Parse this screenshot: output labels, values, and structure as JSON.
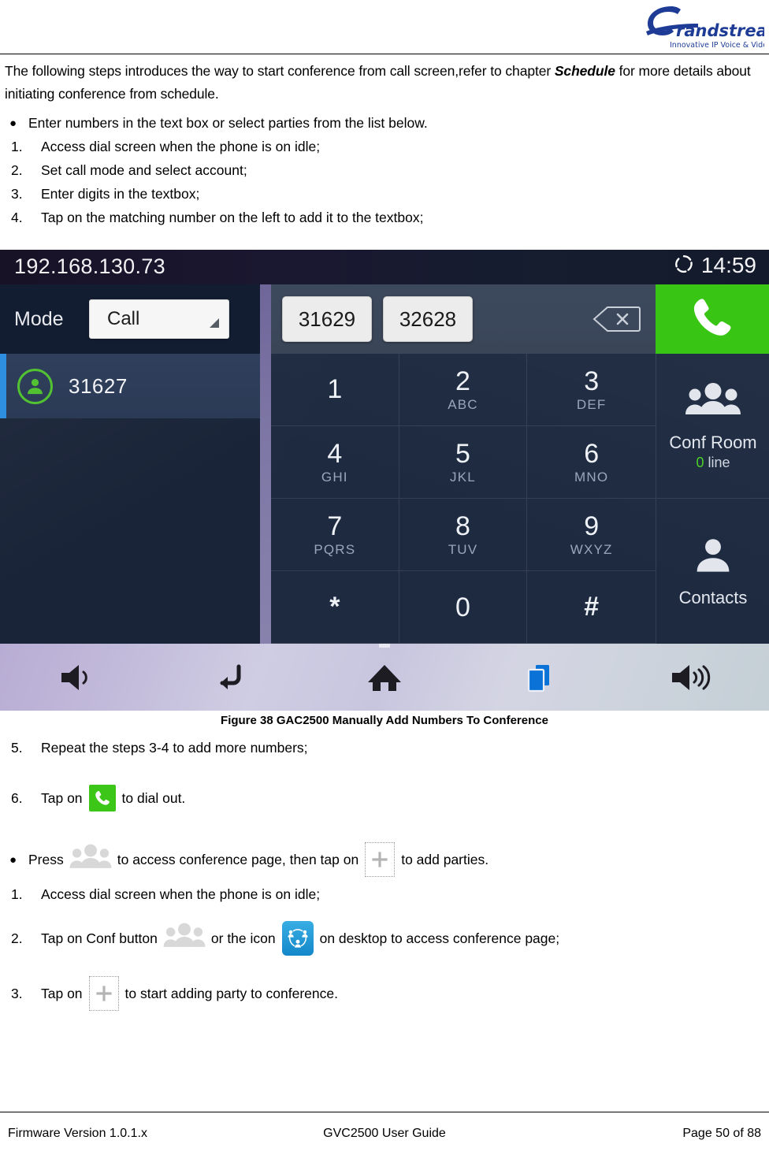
{
  "header": {
    "logo_name": "Grandstream",
    "logo_tagline": "Innovative IP Voice & Video"
  },
  "body": {
    "intro_part1": "The following steps introduces the way to start conference from call screen,refer to chapter ",
    "intro_emphasis": "Schedule",
    "intro_part2": " for more details about initiating conference from schedule.",
    "bullet1": "Enter numbers in the text box or select parties from the list below.",
    "steps_before": [
      {
        "index": "1.",
        "text": "Access dial screen when the phone is on idle;"
      },
      {
        "index": "2.",
        "text": "Set call mode and select account;"
      },
      {
        "index": "3.",
        "text": "Enter digits in the textbox;"
      },
      {
        "index": "4.",
        "text": "Tap on the matching number on the left to add it to the textbox;"
      }
    ]
  },
  "figure": {
    "caption": "Figure 38 GAC2500 Manually Add Numbers To Conference"
  },
  "screenshot": {
    "status": {
      "ip_address": "192.168.130.73",
      "clock": "14:59",
      "status_icon": "sync-circle-icon"
    },
    "mode": {
      "label": "Mode",
      "selected": "Call",
      "caret_icon": "dropdown-caret-icon"
    },
    "contact_list": [
      {
        "number": "31627",
        "avatar_icon": "contact-avatar-icon",
        "selected": true
      }
    ],
    "input": {
      "chips": [
        "31629",
        "32628"
      ],
      "backspace_icon": "backspace-icon"
    },
    "call_button": {
      "icon": "phone-handset-icon",
      "color": "#38c513"
    },
    "dialpad": [
      {
        "digit": "1",
        "letters": ""
      },
      {
        "digit": "2",
        "letters": "ABC"
      },
      {
        "digit": "3",
        "letters": "DEF"
      },
      {
        "digit": "4",
        "letters": "GHI"
      },
      {
        "digit": "5",
        "letters": "JKL"
      },
      {
        "digit": "6",
        "letters": "MNO"
      },
      {
        "digit": "7",
        "letters": "PQRS"
      },
      {
        "digit": "8",
        "letters": "TUV"
      },
      {
        "digit": "9",
        "letters": "WXYZ"
      },
      {
        "digit": "*",
        "letters": ""
      },
      {
        "digit": "0",
        "letters": ""
      },
      {
        "digit": "#",
        "letters": ""
      }
    ],
    "right_rail": {
      "conf_room_label": "Conf Room",
      "conf_room_count": "0",
      "conf_room_unit": " line",
      "conf_room_icon": "group-people-icon",
      "contacts_label": "Contacts",
      "contacts_icon": "person-icon"
    },
    "navbar": [
      {
        "name": "volume-down-icon"
      },
      {
        "name": "back-icon"
      },
      {
        "name": "home-icon"
      },
      {
        "name": "recent-apps-icon"
      },
      {
        "name": "volume-up-icon"
      }
    ]
  },
  "after_figure": {
    "step5_index": "5.",
    "step5_text": "Repeat the steps 3-4 to add more numbers;",
    "step6_index": "6.",
    "step6_pre": "Tap on",
    "step6_post": "to dial out.",
    "bullet2_pre": "Press",
    "bullet2_mid": "to access conference page, then tap on",
    "bullet2_post": "to add parties.",
    "b1_index": "1.",
    "b1_text": "Access dial screen when the phone is on idle;",
    "b2_index": "2.",
    "b2_pre": "Tap on Conf button",
    "b2_mid": "or the icon",
    "b2_post": "on desktop to access conference page;",
    "b3_index": "3.",
    "b3_pre": "Tap on",
    "b3_post": "to start adding party to conference."
  },
  "footer": {
    "left": "Firmware Version 1.0.1.x",
    "center": "GVC2500 User Guide",
    "right": "Page 50 of 88"
  }
}
